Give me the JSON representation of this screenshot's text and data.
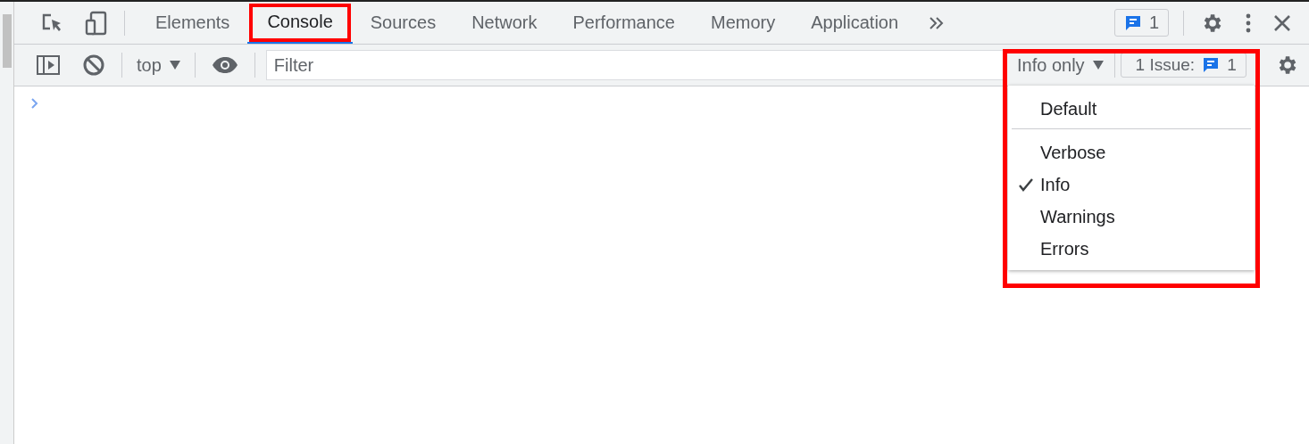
{
  "tabs": [
    {
      "label": "Elements",
      "selected": false,
      "highlighted": false
    },
    {
      "label": "Console",
      "selected": true,
      "highlighted": true
    },
    {
      "label": "Sources",
      "selected": false,
      "highlighted": false
    },
    {
      "label": "Network",
      "selected": false,
      "highlighted": false
    },
    {
      "label": "Performance",
      "selected": false,
      "highlighted": false
    },
    {
      "label": "Memory",
      "selected": false,
      "highlighted": false
    },
    {
      "label": "Application",
      "selected": false,
      "highlighted": false
    }
  ],
  "issues_badge": "1",
  "toolbar": {
    "context": "top",
    "filter": {
      "placeholder": "Filter"
    },
    "levels": {
      "label": "Info only",
      "highlighted": true
    },
    "issues": {
      "label": "1 Issue:",
      "count": "1"
    }
  },
  "level_menu": {
    "sections": [
      {
        "items": [
          {
            "label": "Default",
            "checked": false
          }
        ]
      },
      {
        "items": [
          {
            "label": "Verbose",
            "checked": false
          },
          {
            "label": "Info",
            "checked": true
          },
          {
            "label": "Warnings",
            "checked": false
          },
          {
            "label": "Errors",
            "checked": false
          }
        ]
      }
    ]
  }
}
